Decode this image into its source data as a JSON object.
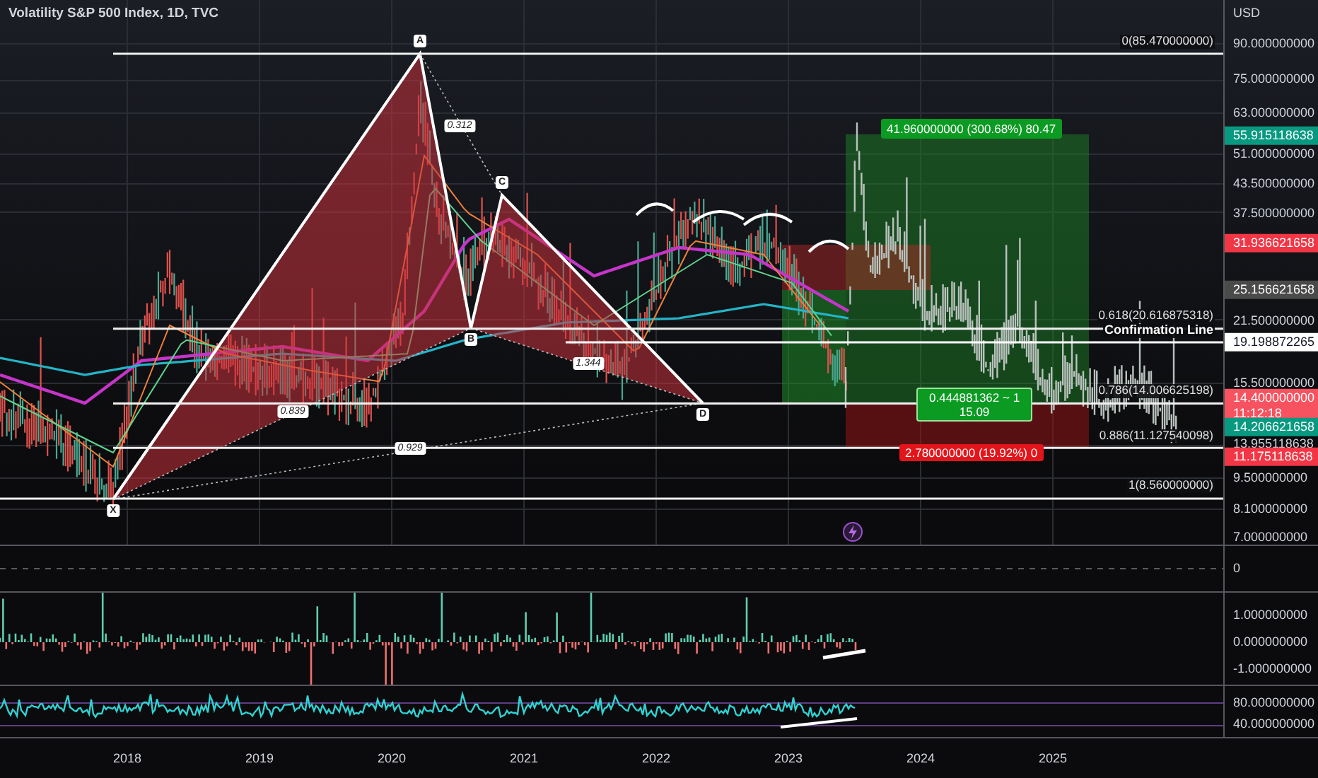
{
  "title": "Volatility S&P 500 Index, 1D, TVC",
  "price_axis": {
    "unit": "USD",
    "ticks": [
      "90.000000000",
      "75.000000000",
      "63.000000000",
      "51.000000000",
      "43.500000000",
      "37.500000000",
      "21.500000000",
      "15.500000000",
      "13.955118638",
      "9.500000000",
      "8.100000000",
      "7.000000000"
    ]
  },
  "price_badges": [
    {
      "value": "55.915118638",
      "color": "#089981"
    },
    {
      "value": "31.936621658",
      "color": "#f23645"
    },
    {
      "value": "25.156621658",
      "color": "#4a4a4a"
    },
    {
      "value": "19.198872265",
      "color": "#ffffff"
    },
    {
      "value": "14.400000000",
      "countdown": "11:12:18",
      "color": "#f7525f"
    },
    {
      "value": "14.206621658",
      "color": "#089981"
    },
    {
      "value": "11.175118638",
      "color": "#f23645"
    }
  ],
  "fib_levels": [
    {
      "label": "0(85.470000000)"
    },
    {
      "label": "0.618(20.616875318)"
    },
    {
      "label": "0.786(14.006625198)"
    },
    {
      "label": "0.886(11.127540098)"
    },
    {
      "label": "1(8.560000000)"
    }
  ],
  "confirmation_line": {
    "label": "Confirmation Line"
  },
  "pattern_points": [
    "X",
    "A",
    "B",
    "C",
    "D"
  ],
  "pattern_ratios": [
    "0.312",
    "0.839",
    "0.929",
    "1.344"
  ],
  "position": {
    "target": "41.960000000 (300.68%) 80.47",
    "ratio": "0.444881362 ~ 1",
    "ratio_value": "15.09",
    "stop": "2.780000000 (19.92%) 0"
  },
  "panes": [
    {
      "ticks": [
        "0"
      ]
    },
    {
      "ticks": [
        "1.000000000",
        "0.000000000",
        "-1.000000000"
      ]
    },
    {
      "ticks": [
        "80.000000000",
        "40.000000000"
      ]
    }
  ],
  "time_axis": [
    "2018",
    "2019",
    "2020",
    "2021",
    "2022",
    "2023",
    "2024",
    "2025"
  ]
}
